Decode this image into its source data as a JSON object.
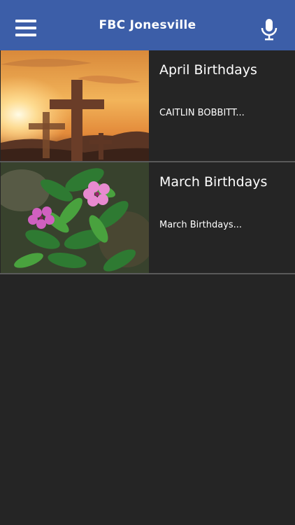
{
  "header": {
    "title": "FBC Jonesville",
    "menu_icon": "hamburger-menu-icon",
    "mic_icon": "microphone-icon",
    "bar_color": "#3c5ea8"
  },
  "items": [
    {
      "title": "April Birthdays",
      "subtitle": "CAITLIN BOBBITT...",
      "image": "crosses-sunset"
    },
    {
      "title": "March Birthdays",
      "subtitle": "March Birthdays...",
      "image": "pink-flowers"
    }
  ],
  "background_color": "#252525"
}
